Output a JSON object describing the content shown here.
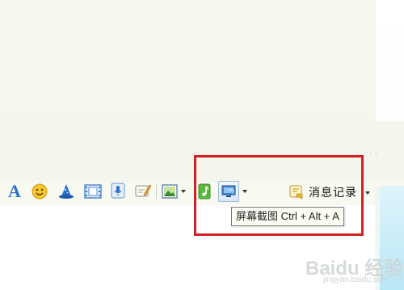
{
  "toolbar": {
    "items": [
      {
        "name": "font-icon",
        "glyph": "A"
      },
      {
        "name": "emoji-icon"
      },
      {
        "name": "magic-emoticon-icon"
      },
      {
        "name": "film-icon"
      },
      {
        "name": "microphone-icon"
      },
      {
        "name": "send-doodle-icon"
      },
      {
        "name": "image-icon",
        "has_dropdown": true
      },
      {
        "name": "music-icon"
      }
    ],
    "screenshot_button": {
      "name": "screenshot-icon",
      "has_dropdown": true
    },
    "history": {
      "label": "消息记录",
      "icon": "chat-history-icon",
      "has_dropdown": true
    }
  },
  "tooltip": {
    "text": "屏幕截图 Ctrl + Alt + A"
  },
  "watermark": {
    "text": "Baidu 经验",
    "sub": "jingyan.baidu.com"
  },
  "colors": {
    "highlight": "#d32020",
    "accent": "#2a6fc7",
    "panel": "#b8e7f5"
  }
}
